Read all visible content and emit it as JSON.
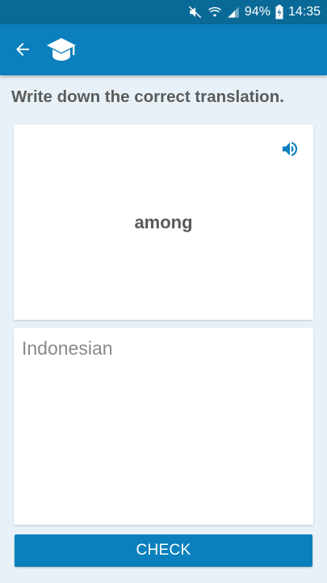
{
  "status_bar": {
    "battery_percent": "94%",
    "time": "14:35",
    "icons": [
      "mute-icon",
      "wifi-icon",
      "signal-icon",
      "battery-charging-icon"
    ]
  },
  "app_bar": {
    "icons": [
      "arrow-left-icon",
      "graduation-cap-icon"
    ],
    "color": "#0b80bd"
  },
  "exercise": {
    "prompt": "Write down the correct translation.",
    "word": "among",
    "speaker_icon": "speaker-icon",
    "answer_placeholder": "Indonesian",
    "answer_value": ""
  },
  "actions": {
    "check_label": "CHECK"
  },
  "colors": {
    "accent": "#0b80bd",
    "status_bar": "#0a6a97",
    "background": "#e8f1f7"
  }
}
